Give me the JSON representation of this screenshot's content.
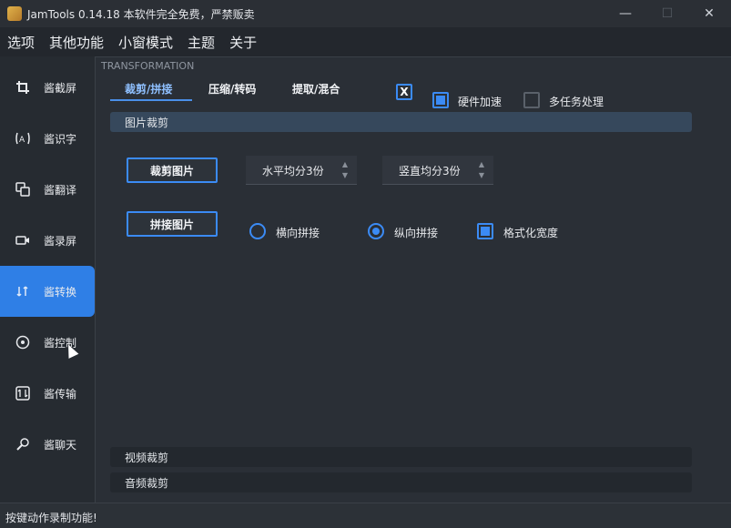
{
  "window": {
    "title": "JamTools 0.14.18 本软件完全免费，严禁贩卖",
    "minimize_icon": "minimize-icon",
    "maximize_icon": "maximize-icon",
    "close_icon": "close-icon",
    "minimize_glyph": "—",
    "maximize_glyph": "☐",
    "close_glyph": "✕"
  },
  "menu": {
    "items": [
      "选项",
      "其他功能",
      "小窗模式",
      "主题",
      "关于"
    ]
  },
  "sidebar": {
    "items": [
      {
        "label": "酱截屏",
        "icon": "crop-icon",
        "glyph": "⌐"
      },
      {
        "label": "酱识字",
        "icon": "ocr-icon",
        "glyph": "(A)"
      },
      {
        "label": "酱翻译",
        "icon": "translate-icon",
        "glyph": "⧉"
      },
      {
        "label": "酱录屏",
        "icon": "record-icon",
        "glyph": "▭"
      },
      {
        "label": "酱转换",
        "icon": "transform-icon",
        "glyph": "⇅"
      },
      {
        "label": "酱控制",
        "icon": "control-icon",
        "glyph": "⊕"
      },
      {
        "label": "酱传输",
        "icon": "transfer-icon",
        "glyph": "⇵"
      },
      {
        "label": "酱聊天",
        "icon": "chat-icon",
        "glyph": "⌕"
      }
    ],
    "active_index": 4
  },
  "main": {
    "section_title": "TRANSFORMATION",
    "tabs": [
      "裁剪/拼接",
      "压缩/转码",
      "提取/混合"
    ],
    "active_tab": 0,
    "toggle_x_label": "X",
    "hardware_accel_label": "硬件加速",
    "hardware_accel_checked": true,
    "multitask_label": "多任务处理",
    "multitask_checked": false,
    "image_crop_header": "图片裁剪",
    "crop_image_button": "裁剪图片",
    "horizontal_split": "水平均分3份",
    "vertical_split": "竖直均分3份",
    "stitch_image_button": "拼接图片",
    "radio_horizontal": "横向拼接",
    "radio_vertical": "纵向拼接",
    "radio_selected": "vertical",
    "format_width_label": "格式化宽度",
    "format_width_checked": true,
    "video_crop_header": "视频裁剪",
    "audio_crop_header": "音频裁剪"
  },
  "status": {
    "text": "按键动作录制功能!"
  },
  "colors": {
    "accent": "#3b8bf5",
    "active_sidebar": "#2f7fe6",
    "background": "#2a2f36"
  }
}
